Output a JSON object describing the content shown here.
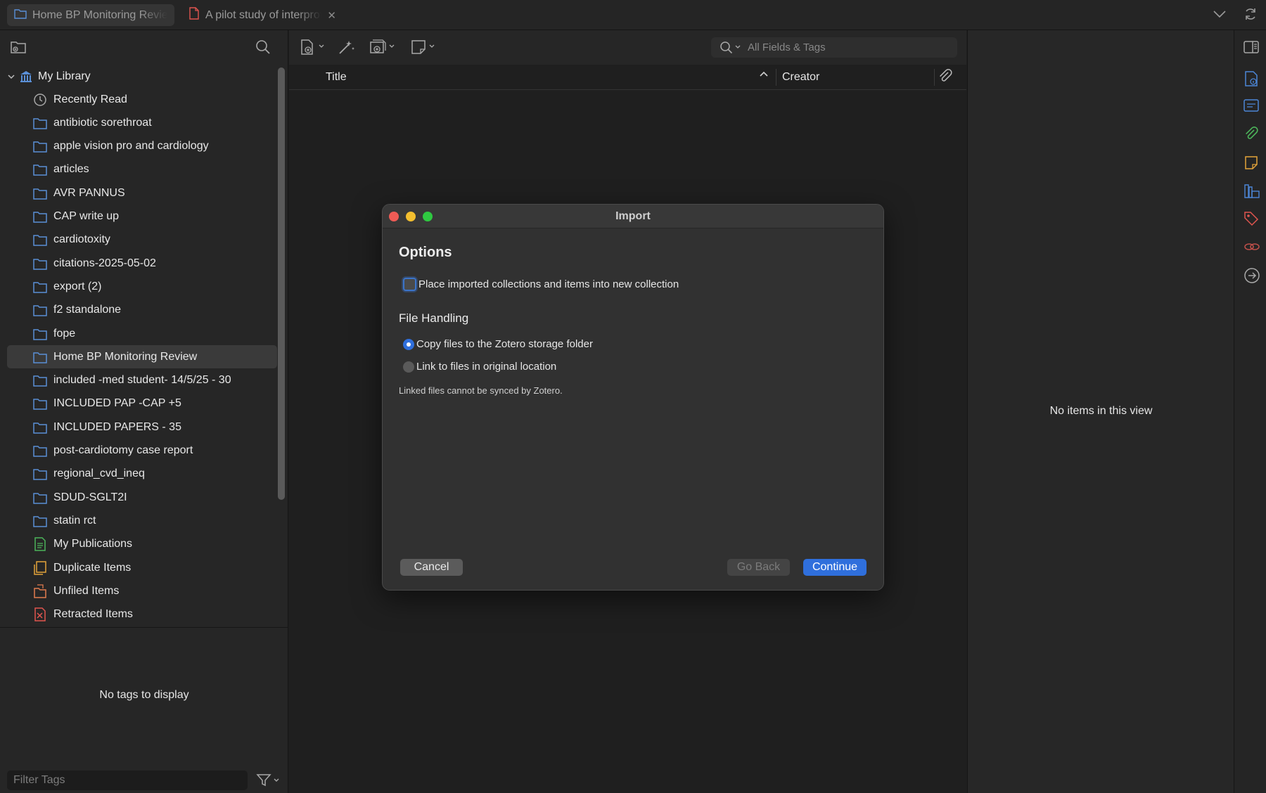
{
  "tabs": [
    {
      "label": "Home BP Monitoring Review",
      "icon": "folder-icon"
    },
    {
      "label": "A pilot study of interprofessional",
      "icon": "pdf-icon"
    }
  ],
  "library": {
    "root_label": "My Library",
    "items": [
      {
        "label": "Recently Read",
        "icon": "clock-icon"
      },
      {
        "label": "antibiotic sorethroat",
        "icon": "folder-icon"
      },
      {
        "label": "apple vision pro and cardiology",
        "icon": "folder-icon"
      },
      {
        "label": "articles",
        "icon": "folder-icon"
      },
      {
        "label": "AVR PANNUS",
        "icon": "folder-icon"
      },
      {
        "label": "CAP write up",
        "icon": "folder-icon"
      },
      {
        "label": "cardiotoxity",
        "icon": "folder-icon"
      },
      {
        "label": "citations-2025-05-02",
        "icon": "folder-icon"
      },
      {
        "label": "export (2)",
        "icon": "folder-icon"
      },
      {
        "label": "f2 standalone",
        "icon": "folder-icon"
      },
      {
        "label": "fope",
        "icon": "folder-icon"
      },
      {
        "label": "Home BP Monitoring Review",
        "icon": "folder-icon"
      },
      {
        "label": "included -med student- 14/5/25 - 30",
        "icon": "folder-icon"
      },
      {
        "label": "INCLUDED PAP -CAP +5",
        "icon": "folder-icon"
      },
      {
        "label": "INCLUDED PAPERS - 35",
        "icon": "folder-icon"
      },
      {
        "label": "post-cardiotomy case report",
        "icon": "folder-icon"
      },
      {
        "label": "regional_cvd_ineq",
        "icon": "folder-icon"
      },
      {
        "label": "SDUD-SGLT2I",
        "icon": "folder-icon"
      },
      {
        "label": "statin rct",
        "icon": "folder-icon"
      },
      {
        "label": "My Publications",
        "icon": "publications-icon"
      },
      {
        "label": "Duplicate Items",
        "icon": "duplicate-icon"
      },
      {
        "label": "Unfiled Items",
        "icon": "unfiled-icon"
      },
      {
        "label": "Retracted Items",
        "icon": "retracted-icon"
      }
    ],
    "selected": "Home BP Monitoring Review"
  },
  "tags": {
    "empty_text": "No tags to display",
    "filter_placeholder": "Filter Tags"
  },
  "items_pane": {
    "search_placeholder": "All Fields & Tags",
    "columns": [
      "Title",
      "Creator"
    ]
  },
  "item_pane": {
    "empty_text": "No items in this view"
  },
  "dialog": {
    "title": "Import",
    "heading": "Options",
    "checkbox_label": "Place imported collections and items into new collection",
    "file_handling_heading": "File Handling",
    "radio_copy_label": "Copy files to the Zotero storage folder",
    "radio_link_label": "Link to files in original location",
    "note": "Linked files cannot be synced by Zotero.",
    "buttons": {
      "cancel": "Cancel",
      "back": "Go Back",
      "continue": "Continue"
    },
    "selected_option": "Copy files to the Zotero storage folder",
    "checkbox_checked": false
  },
  "colors": {
    "accent": "#2f6fdc",
    "close": "#ee5b55",
    "minimize": "#f3be2f",
    "zoom": "#2fc841",
    "folder": "#5a8fd6"
  }
}
